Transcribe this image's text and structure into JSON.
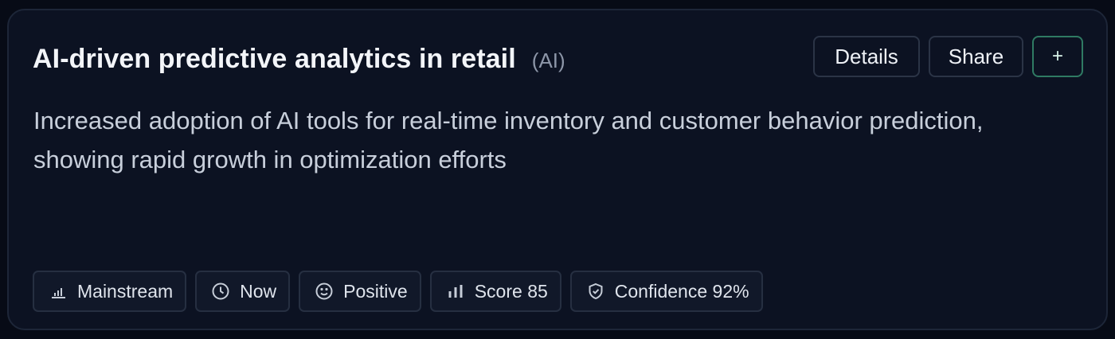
{
  "card": {
    "title": "AI-driven predictive analytics in retail",
    "tag": "(AI)",
    "description": "Increased adoption of AI tools for real-time inventory and customer behavior prediction, showing rapid growth in optimization efforts",
    "actions": {
      "details_label": "Details",
      "share_label": "Share",
      "add_label": "+"
    },
    "chips": [
      {
        "label": "Mainstream",
        "icon": "bar-chart-small-icon"
      },
      {
        "label": "Now",
        "icon": "clock-icon"
      },
      {
        "label": "Positive",
        "icon": "smiley-icon"
      },
      {
        "label": "Score 85",
        "icon": "bar-chart-icon"
      },
      {
        "label": "Confidence 92%",
        "icon": "shield-check-icon"
      }
    ]
  },
  "colors": {
    "background": "#070b16",
    "card": "#0c1222",
    "accent_border": "#2f7a63"
  }
}
